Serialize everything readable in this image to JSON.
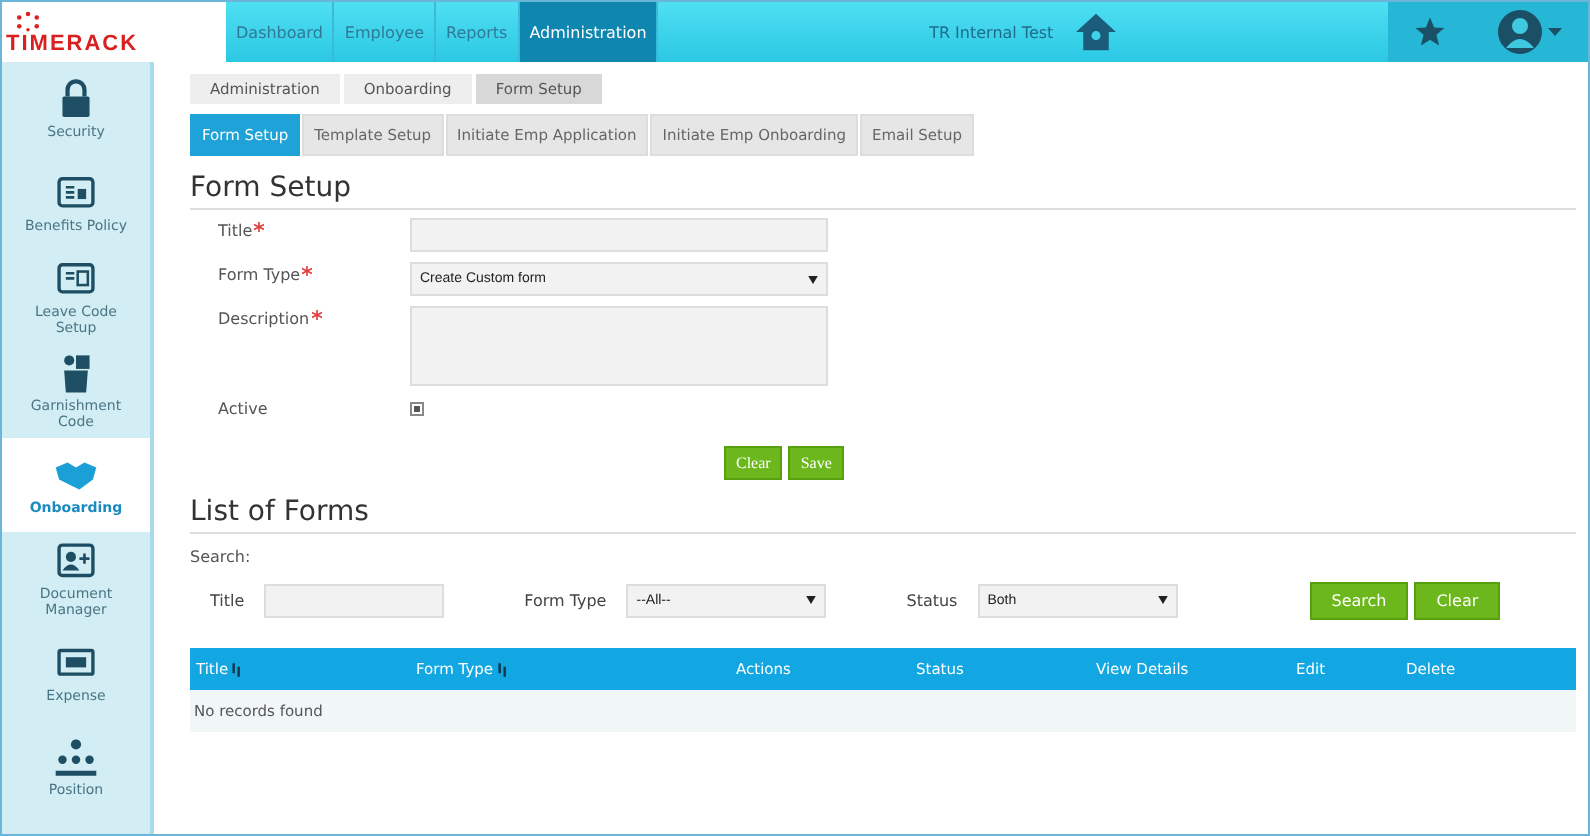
{
  "logo": {
    "text": "TIMERACK"
  },
  "nav": [
    {
      "label": "Dashboard",
      "selected": false
    },
    {
      "label": "Employee",
      "selected": false
    },
    {
      "label": "Reports",
      "selected": false
    },
    {
      "label": "Administration",
      "selected": true
    }
  ],
  "company": "TR Internal Test",
  "sidebar": {
    "items": [
      {
        "label": "Security",
        "selected": false
      },
      {
        "label": "Benefits Policy",
        "selected": false
      },
      {
        "label": "Leave Code Setup",
        "selected": false
      },
      {
        "label": "Garnishment Code",
        "selected": false
      },
      {
        "label": "Onboarding",
        "selected": true
      },
      {
        "label": "Document Manager",
        "selected": false
      },
      {
        "label": "Expense",
        "selected": false
      },
      {
        "label": "Position",
        "selected": false
      }
    ]
  },
  "breadcrumb": [
    "Administration",
    "Onboarding",
    "Form Setup"
  ],
  "tabs": [
    {
      "label": "Form Setup",
      "selected": true
    },
    {
      "label": "Template Setup",
      "selected": false
    },
    {
      "label": "Initiate Emp Application",
      "selected": false
    },
    {
      "label": "Initiate Emp Onboarding",
      "selected": false
    },
    {
      "label": "Email Setup",
      "selected": false
    }
  ],
  "form": {
    "heading": "Form Setup",
    "fields": [
      {
        "kind": "text",
        "label": "Title",
        "required": true
      },
      {
        "kind": "select",
        "label": "Form Type",
        "required": true,
        "value": "Create Custom form"
      },
      {
        "kind": "textarea",
        "label": "Description",
        "required": true
      },
      {
        "kind": "checkbox",
        "label": "Active",
        "required": false,
        "checked": true
      }
    ],
    "buttons": [
      "Clear",
      "Save"
    ]
  },
  "list": {
    "heading": "List of Forms",
    "search_label": "Search:",
    "filters": [
      {
        "kind": "text",
        "label": "Title"
      },
      {
        "kind": "select",
        "label": "Form Type",
        "value": "--All--"
      },
      {
        "kind": "select",
        "label": "Status",
        "value": "Both"
      }
    ],
    "buttons": [
      "Search",
      "Clear"
    ],
    "columns": [
      {
        "label": "Title",
        "sortable": true
      },
      {
        "label": "Form Type",
        "sortable": true
      },
      {
        "label": "Actions",
        "sortable": false
      },
      {
        "label": "Status",
        "sortable": false
      },
      {
        "label": "View Details",
        "sortable": false
      },
      {
        "label": "Edit",
        "sortable": false
      },
      {
        "label": "Delete",
        "sortable": false
      }
    ],
    "empty": "No records found"
  }
}
